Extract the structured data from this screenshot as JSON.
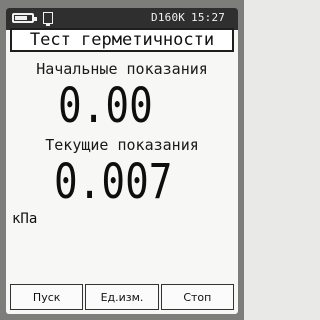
{
  "status_bar": {
    "battery_level": 0.75,
    "device_id": "D160K",
    "time": "15:27",
    "icons": [
      "battery-icon",
      "usb-icon"
    ]
  },
  "title": "Тест герметичности",
  "readings": {
    "initial_label": "Начальные показания",
    "initial_value": "0.00",
    "current_label": "Текущие показания",
    "current_value": "0.007",
    "unit": "кПа"
  },
  "softkeys": {
    "start": "Пуск",
    "units": "Ед.изм.",
    "stop": "Стоп"
  },
  "colors": {
    "status_bar_bg": "#2f2f2f",
    "screen_bg": "#f7f7f5",
    "text": "#111111"
  }
}
